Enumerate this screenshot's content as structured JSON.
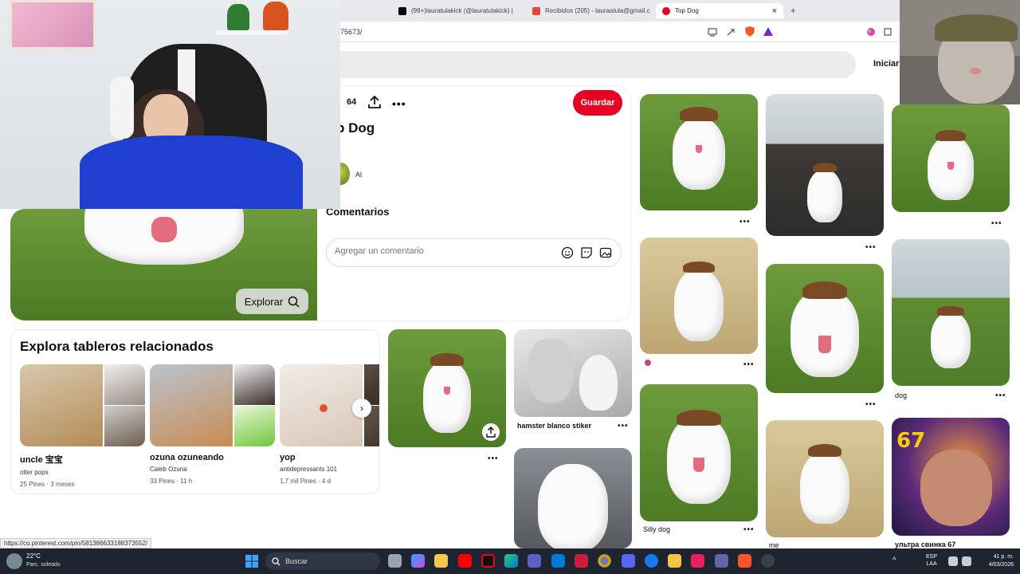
{
  "browser": {
    "tabs": [
      {
        "label": "(99+)lauratulakick (@lauratulakick) |",
        "color": "#000000"
      },
      {
        "label": "Recibidos (205) - lauraatula@gmail.c",
        "color": "#ea4335"
      },
      {
        "label": "Top Dog",
        "color": "#e60023"
      }
    ],
    "new_tab": "+",
    "close_tab": "×",
    "url": "75673/"
  },
  "header": {
    "login": "Iniciar s"
  },
  "pin": {
    "likes": "64",
    "title": "p Dog",
    "save_label": "Guardar",
    "author": "Al",
    "comments_heading": "Comentarios",
    "comment_placeholder": "Agregar un comentario",
    "explore_label": "Explorar",
    "more": "•••"
  },
  "related_boards": {
    "heading": "Explora tableros relacionados",
    "boards": [
      {
        "name": "uncle 宝宝",
        "owner": "otter pops",
        "meta": "25 Pines · 3 meses"
      },
      {
        "name": "ozuna ozuneando",
        "owner": "Caleb Ozuna",
        "meta": "33 Pines · 11 h"
      },
      {
        "name": "yop",
        "owner": "antidepressants 101",
        "meta": "1,7 mil Pines · 4 d"
      }
    ],
    "next": "›"
  },
  "pins": {
    "captions": {
      "hamster": "hamster blanco stiker",
      "dog": "dog",
      "silly": "Silly dog",
      "me": "me",
      "svinka": "ультра свинка 67"
    },
    "dots": "•••"
  },
  "status_url": "https://co.pinterest.com/pin/581386633188373552/",
  "taskbar": {
    "temp": "22°C",
    "weather": "Parc. soleado",
    "search_placeholder": "Buscar",
    "lang_1": "ESP",
    "lang_2": "LAA",
    "time": "41 p. m.",
    "date": "4/03/2026"
  },
  "colors": {
    "accent": "#e60023",
    "taskbar": "#1f2530"
  }
}
